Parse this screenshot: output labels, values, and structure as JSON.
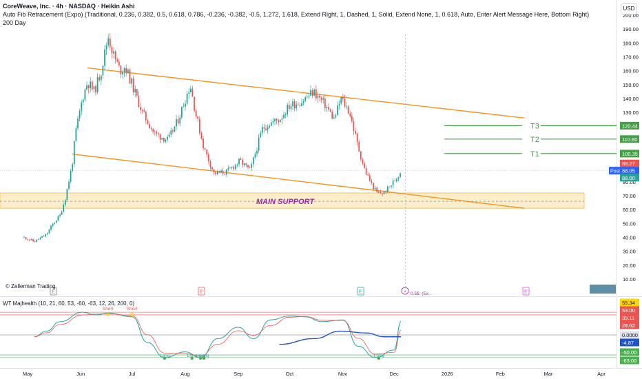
{
  "header": {
    "symbol_line": "CoreWeave, Inc. · 4h · NASDAQ · Heikin Ashi",
    "fib_line": "Auto Fib Retracement (Expo) (Traditional, 0.236, 0.382, 0.5, 0.618, 0.786, -0.236, -0.382, -0.5, 1.272, 1.618, Extend Right, 1, Dashed, 1, Solid, Extend None, 1, 0.618, Auto, Enter Alert Message Here, Bottom Right)",
    "ma_line": "200 Day",
    "currency": "USD"
  },
  "watermark": "© Zellerman Trading",
  "colors": {
    "up": "#26a69a",
    "down": "#ef5350",
    "channel": "#f7931a",
    "support_fill": "#fbe8b8",
    "support_text": "#9c27b0",
    "target": "#43a047",
    "ma": "#1e53c9",
    "price_label": "#26a69a",
    "post_label": "#2962ff"
  },
  "chart_data": [
    {
      "type": "candlestick",
      "title": "CoreWeave, Inc. · 4h · NASDAQ · Heikin Ashi",
      "x_ticks": [
        "May",
        "Jun",
        "Jul",
        "Aug",
        "Sep",
        "Oct",
        "Nov",
        "Dec",
        "2026",
        "Feb",
        "Mar",
        "Apr"
      ],
      "y_ticks": [
        10,
        20,
        30,
        40,
        50,
        60,
        70,
        80,
        90,
        100,
        110,
        120,
        130,
        140,
        150,
        160,
        170,
        180,
        190,
        200
      ],
      "y_tick_labels": [
        "10.00",
        "20.00",
        "30.00",
        "40.00",
        "50.00",
        "60.00",
        "70.00",
        "80.00",
        "90.00",
        "100.00",
        "110.00",
        "120.00",
        "130.00",
        "140.00",
        "150.00",
        "160.00",
        "170.00",
        "180.00",
        "190.00",
        "200.00"
      ],
      "ylim": [
        2,
        205
      ],
      "series": [
        {
          "name": "Price path (approx. closes)",
          "points": [
            [
              "Apr-29",
              40
            ],
            [
              "May-05",
              37
            ],
            [
              "May-12",
              42
            ],
            [
              "May-16",
              50
            ],
            [
              "May-20",
              56
            ],
            [
              "May-23",
              68
            ],
            [
              "May-27",
              92
            ],
            [
              "May-29",
              115
            ],
            [
              "Jun-02",
              140
            ],
            [
              "Jun-05",
              152
            ],
            [
              "Jun-09",
              145
            ],
            [
              "Jun-13",
              160
            ],
            [
              "Jun-17",
              185
            ],
            [
              "Jun-20",
              172
            ],
            [
              "Jun-24",
              160
            ],
            [
              "Jun-27",
              163
            ],
            [
              "Jul-01",
              150
            ],
            [
              "Jul-07",
              130
            ],
            [
              "Jul-14",
              115
            ],
            [
              "Jul-22",
              110
            ],
            [
              "Jul-28",
              125
            ],
            [
              "Aug-04",
              150
            ],
            [
              "Aug-07",
              130
            ],
            [
              "Aug-12",
              104
            ],
            [
              "Aug-18",
              86
            ],
            [
              "Aug-25",
              87
            ],
            [
              "Sep-02",
              95
            ],
            [
              "Sep-08",
              88
            ],
            [
              "Sep-15",
              118
            ],
            [
              "Sep-19",
              122
            ],
            [
              "Sep-25",
              125
            ],
            [
              "Oct-01",
              135
            ],
            [
              "Oct-08",
              138
            ],
            [
              "Oct-15",
              145
            ],
            [
              "Oct-22",
              135
            ],
            [
              "Oct-27",
              125
            ],
            [
              "Oct-31",
              140
            ],
            [
              "Nov-05",
              130
            ],
            [
              "Nov-10",
              105
            ],
            [
              "Nov-14",
              88
            ],
            [
              "Nov-18",
              78
            ],
            [
              "Nov-21",
              72
            ],
            [
              "Nov-25",
              72
            ],
            [
              "Nov-28",
              76
            ],
            [
              "Dec-02",
              82
            ],
            [
              "Dec-05",
              88
            ]
          ]
        },
        {
          "name": "Upper channel",
          "points": [
            [
              "Jun-05",
              162
            ],
            [
              "Feb-15",
              126
            ]
          ]
        },
        {
          "name": "Lower channel",
          "points": [
            [
              "May-27",
              100
            ],
            [
              "Feb-15",
              61
            ]
          ]
        },
        {
          "name": "MAIN SUPPORT zone",
          "range": [
            61,
            72
          ]
        }
      ],
      "annotations": [
        {
          "label": "MAIN SUPPORT",
          "value": 66
        },
        {
          "label": "T3",
          "value": 120.44
        },
        {
          "label": "T2",
          "value": 110.8
        },
        {
          "label": "T1",
          "value": 100.35
        }
      ],
      "price_labels": [
        {
          "text": "120.44",
          "value": 120.44
        },
        {
          "text": "110.80",
          "value": 110.8
        },
        {
          "text": "100.35",
          "value": 100.35
        },
        {
          "text": "88.27",
          "value": 88.27
        },
        {
          "text": "Post",
          "value": 88.05
        },
        {
          "text": "88.05",
          "value": 88.05
        },
        {
          "text": "88.00",
          "value": 88.0
        }
      ],
      "event_markers": [
        "E",
        "E",
        "E",
        "E"
      ],
      "dividend_text": "0.5$: (Ex...",
      "grid": false
    },
    {
      "type": "line",
      "title": "WT Majhealth (10, 21, 60, 53, -60, -63, 12, 26, 200, 0)",
      "x_ticks": [
        "May",
        "Jun",
        "Jul",
        "Aug",
        "Sep",
        "Oct",
        "Nov",
        "Dec",
        "2026",
        "Feb",
        "Mar",
        "Apr"
      ],
      "ylim": [
        -75,
        70
      ],
      "levels": [
        {
          "value": 60,
          "color": "#ef5350"
        },
        {
          "value": 53,
          "color": "#ef5350"
        },
        {
          "value": 0,
          "color": "#787b86"
        },
        {
          "value": -53,
          "color": "#4caf50"
        },
        {
          "value": -60,
          "color": "#4caf50"
        }
      ],
      "series": [
        {
          "name": "WT1",
          "points": [
            [
              "May-05",
              -5
            ],
            [
              "May-12",
              10
            ],
            [
              "May-20",
              35
            ],
            [
              "Jun-02",
              60
            ],
            [
              "Jun-10",
              53
            ],
            [
              "Jun-17",
              58
            ],
            [
              "Jul-01",
              48
            ],
            [
              "Jul-10",
              -20
            ],
            [
              "Jul-20",
              -60
            ],
            [
              "Aug-01",
              -45
            ],
            [
              "Aug-10",
              -60
            ],
            [
              "Aug-20",
              -10
            ],
            [
              "Sep-01",
              20
            ],
            [
              "Sep-10",
              -10
            ],
            [
              "Sep-20",
              40
            ],
            [
              "Oct-01",
              50
            ],
            [
              "Oct-10",
              48
            ],
            [
              "Oct-20",
              35
            ],
            [
              "Nov-01",
              40
            ],
            [
              "Nov-10",
              -30
            ],
            [
              "Nov-20",
              -60
            ],
            [
              "Dec-01",
              -40
            ],
            [
              "Dec-05",
              35
            ]
          ]
        },
        {
          "name": "Slow MA",
          "points": [
            [
              "Sep-25",
              -25
            ],
            [
              "Oct-15",
              -10
            ],
            [
              "Oct-31",
              10
            ],
            [
              "Nov-15",
              5
            ],
            [
              "Nov-25",
              -5
            ],
            [
              "Dec-05",
              -5
            ]
          ]
        }
      ],
      "markers": [
        {
          "text": "Short",
          "x": "Jun-17"
        },
        {
          "text": "Short",
          "x": "Jul-01"
        },
        {
          "text": "Long",
          "x": "Jul-20"
        },
        {
          "text": "Long",
          "x": "Aug-05"
        },
        {
          "text": "Long",
          "x": "Aug-10"
        },
        {
          "text": "Long",
          "x": "Aug-12"
        },
        {
          "text": "Long",
          "x": "Nov-22"
        }
      ],
      "value_labels": [
        {
          "text": "55.34",
          "value": 55.34
        },
        {
          "text": "53.00",
          "value": 53
        },
        {
          "text": "39.11",
          "value": 39.11
        },
        {
          "text": "28.62",
          "value": 28.62
        },
        {
          "text": "0.0000",
          "value": 0
        },
        {
          "text": "-4.87",
          "value": -4.87
        },
        {
          "text": "-50.00",
          "value": -50
        },
        {
          "text": "-63.00",
          "value": -63
        }
      ]
    }
  ]
}
